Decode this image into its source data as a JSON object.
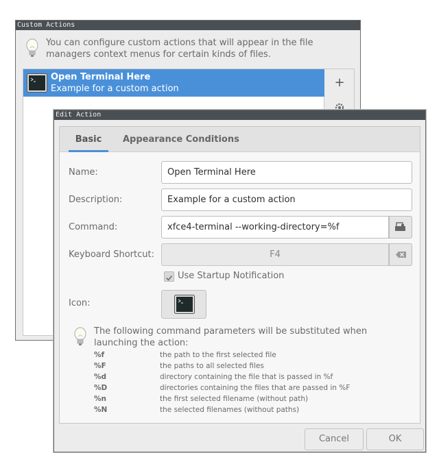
{
  "custom_actions": {
    "title": "Custom Actions",
    "hint": "You can configure custom actions that will appear in the file managers context menus for certain kinds of files.",
    "items": [
      {
        "name": "Open Terminal Here",
        "description": "Example for a custom action",
        "icon": "terminal-icon",
        "selected": true
      }
    ],
    "add_label": "+",
    "settings_icon": "gear-icon"
  },
  "edit_action": {
    "title": "Edit Action",
    "tabs": [
      {
        "label": "Basic",
        "active": true
      },
      {
        "label": "Appearance Conditions",
        "active": false
      }
    ],
    "form": {
      "name_label": "Name:",
      "name_value": "Open Terminal Here",
      "description_label": "Description:",
      "description_value": "Example for a custom action",
      "command_label": "Command:",
      "command_value": "xfce4-terminal --working-directory=%f",
      "command_browse_icon": "printer-icon",
      "shortcut_label": "Keyboard Shortcut:",
      "shortcut_value": "F4",
      "shortcut_clear_icon": "clear-icon",
      "startup_notification_label": "Use Startup Notification",
      "startup_notification_checked": true,
      "icon_label": "Icon:",
      "icon_value": "terminal-icon"
    },
    "help_text": "The following command parameters will be substituted when launching the action:",
    "parameters": [
      {
        "code": "%f",
        "desc": "the path to the first selected file"
      },
      {
        "code": "%F",
        "desc": "the paths to all selected files"
      },
      {
        "code": "%d",
        "desc": "directory containing the file that is passed in %f"
      },
      {
        "code": "%D",
        "desc": "directories containing the files that are passed in %F"
      },
      {
        "code": "%n",
        "desc": "the first selected filename (without path)"
      },
      {
        "code": "%N",
        "desc": "the selected filenames (without paths)"
      }
    ],
    "cancel_label": "Cancel",
    "ok_label": "OK"
  },
  "colors": {
    "accent": "#4a90d9",
    "titlebar": "#4a4f53",
    "window_bg": "#ececec"
  }
}
